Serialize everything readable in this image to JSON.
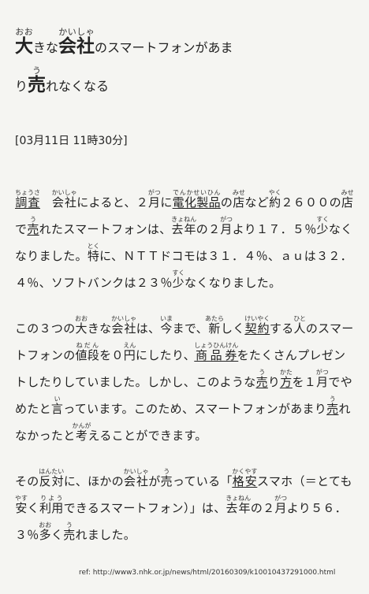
{
  "title": {
    "l1": [
      [
        "大",
        "おお"
      ],
      [
        "きな",
        ""
      ],
      [
        "会社",
        "かいしゃ"
      ],
      [
        "のスマートフォンがあま",
        ""
      ]
    ],
    "l2": [
      [
        "り",
        ""
      ],
      [
        "売",
        "う"
      ],
      [
        "れなくなる",
        ""
      ]
    ]
  },
  "date": "[03月11日 11時30分]",
  "paragraphs": [
    [
      [
        "調査",
        "ちょうさ",
        1
      ],
      [
        "　",
        ""
      ],
      [
        "会社",
        "かいしゃ"
      ],
      [
        "によると、２",
        ""
      ],
      [
        "月",
        "がつ"
      ],
      [
        "に",
        ""
      ],
      [
        "電化製品",
        "でんかせいひん",
        1
      ],
      [
        "の",
        ""
      ],
      [
        "店",
        "みせ"
      ],
      [
        "など",
        ""
      ],
      [
        "約",
        "やく"
      ],
      [
        "２６００の",
        ""
      ],
      [
        "店",
        "みせ"
      ],
      [
        "で",
        ""
      ],
      [
        "売",
        "う",
        1
      ],
      [
        "れたスマートフォンは、",
        ""
      ],
      [
        "去年",
        "きょねん"
      ],
      [
        "の２",
        ""
      ],
      [
        "月",
        "がつ"
      ],
      [
        "より１７．５％",
        ""
      ],
      [
        "少",
        "すく"
      ],
      [
        "なくなりました。",
        ""
      ],
      [
        "特",
        "とく"
      ],
      [
        "に、ＮＴＴドコモは３１．４％、ａｕは３２．４％、ソフトバンクは２３％",
        ""
      ],
      [
        "少",
        "すく"
      ],
      [
        "なくなりました。",
        ""
      ]
    ],
    [
      [
        "この３つの",
        ""
      ],
      [
        "大",
        "おお"
      ],
      [
        "きな",
        ""
      ],
      [
        "会社",
        "かいしゃ"
      ],
      [
        "は、",
        ""
      ],
      [
        "今",
        "いま"
      ],
      [
        "まで、",
        ""
      ],
      [
        "新",
        "あたら"
      ],
      [
        "しく",
        ""
      ],
      [
        "契約",
        "けいやく",
        1
      ],
      [
        "する",
        ""
      ],
      [
        "人",
        "ひと"
      ],
      [
        "のスマートフォンの",
        ""
      ],
      [
        "値段",
        "ねだん"
      ],
      [
        "を０",
        ""
      ],
      [
        "円",
        "えん"
      ],
      [
        "にしたり、",
        ""
      ],
      [
        "商品券",
        "しょうひんけん",
        1
      ],
      [
        "をたくさんプレゼントしたりしていました。しかし、このような",
        ""
      ],
      [
        "売",
        "う",
        1
      ],
      [
        "り",
        ""
      ],
      [
        "方",
        "かた",
        1
      ],
      [
        "を１",
        ""
      ],
      [
        "月",
        "がつ"
      ],
      [
        "でやめたと",
        ""
      ],
      [
        "言",
        "い"
      ],
      [
        "っています。このため、スマートフォンがあまり",
        ""
      ],
      [
        "売",
        "う",
        1
      ],
      [
        "れなかったと",
        ""
      ],
      [
        "考",
        "かんが"
      ],
      [
        "えることができます。",
        ""
      ]
    ],
    [
      [
        "その",
        ""
      ],
      [
        "反対",
        "はんたい"
      ],
      [
        "に、ほかの",
        ""
      ],
      [
        "会社",
        "かいしゃ"
      ],
      [
        "が",
        ""
      ],
      [
        "売",
        "う"
      ],
      [
        "っている「",
        ""
      ],
      [
        "格安",
        "かくやす",
        1
      ],
      [
        "スマホ（＝とても",
        ""
      ],
      [
        "安",
        "やす"
      ],
      [
        "く",
        ""
      ],
      [
        "利用",
        "りよう"
      ],
      [
        "できるスマートフォン）」は、",
        ""
      ],
      [
        "去年",
        "きょねん"
      ],
      [
        "の２",
        ""
      ],
      [
        "月",
        "がつ"
      ],
      [
        "より５６．３％",
        ""
      ],
      [
        "多",
        "おお"
      ],
      [
        "く",
        ""
      ],
      [
        "売",
        "う"
      ],
      [
        "れました。",
        ""
      ]
    ]
  ],
  "reference": "ref: http://www3.nhk.or.jp/news/html/20160309/k10010437291000.html"
}
